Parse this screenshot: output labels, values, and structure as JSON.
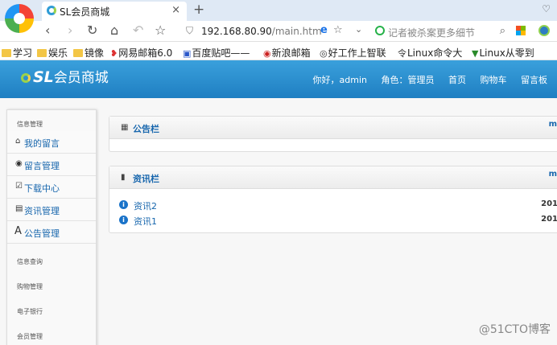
{
  "browser": {
    "tab_title": "SL会员商城",
    "new_tab": "+",
    "close": "×",
    "back": "‹",
    "forward": "›",
    "reload": "↻",
    "home": "⌂",
    "undo": "↶",
    "favorite": "☆",
    "url_host": "192.168.80.90",
    "url_path": "/main.htm",
    "ie_mode": "e",
    "star": "☆",
    "dropdown": "⌄",
    "search_placeholder": "记者被杀案更多细节",
    "search": "⌕",
    "menu": "♡"
  },
  "bookmarks": [
    {
      "label": "学习",
      "icon": "folder-icon"
    },
    {
      "label": "娱乐",
      "icon": "folder-icon"
    },
    {
      "label": "镜像",
      "icon": "folder-icon"
    },
    {
      "label": "网易邮箱6.0",
      "icon": "netease-icon",
      "glyph": "❥"
    },
    {
      "label": "百度贴吧——",
      "icon": "baidu-icon",
      "glyph": "▣"
    },
    {
      "label": "新浪邮箱",
      "icon": "sina-icon",
      "glyph": "◉"
    },
    {
      "label": "好工作上智联",
      "icon": "zhilian-icon",
      "glyph": "◎"
    },
    {
      "label": "Linux命令大",
      "icon": "linux-icon",
      "glyph": "令"
    },
    {
      "label": "Linux从零到",
      "icon": "linux2-icon",
      "glyph": "▼"
    }
  ],
  "site": {
    "logo_sl": "SL",
    "logo_text": "会员商城",
    "nav": {
      "greeting": "你好，admin",
      "role": "角色：管理员",
      "home": "首页",
      "cart": "购物车",
      "board": "留言板"
    }
  },
  "sidebar": {
    "group_info": "信息管理",
    "items": [
      {
        "label": "我的留言",
        "glyph": "⌂"
      },
      {
        "label": "留言管理",
        "glyph": "◉"
      },
      {
        "label": "下载中心",
        "glyph": "☑"
      },
      {
        "label": "资讯管理",
        "glyph": "▤"
      },
      {
        "label": "公告管理",
        "glyph": "A"
      }
    ],
    "groups": [
      "信息查询",
      "购物管理",
      "电子银行",
      "会员管理"
    ]
  },
  "panels": {
    "notice": {
      "title": "公告栏",
      "more": "m",
      "glyph": "▦"
    },
    "news": {
      "title": "资讯栏",
      "more": "m",
      "glyph": "▮",
      "rows": [
        {
          "title": "资讯2",
          "date": "201"
        },
        {
          "title": "资讯1",
          "date": "201"
        }
      ]
    }
  },
  "watermark": "@51CTO博客"
}
